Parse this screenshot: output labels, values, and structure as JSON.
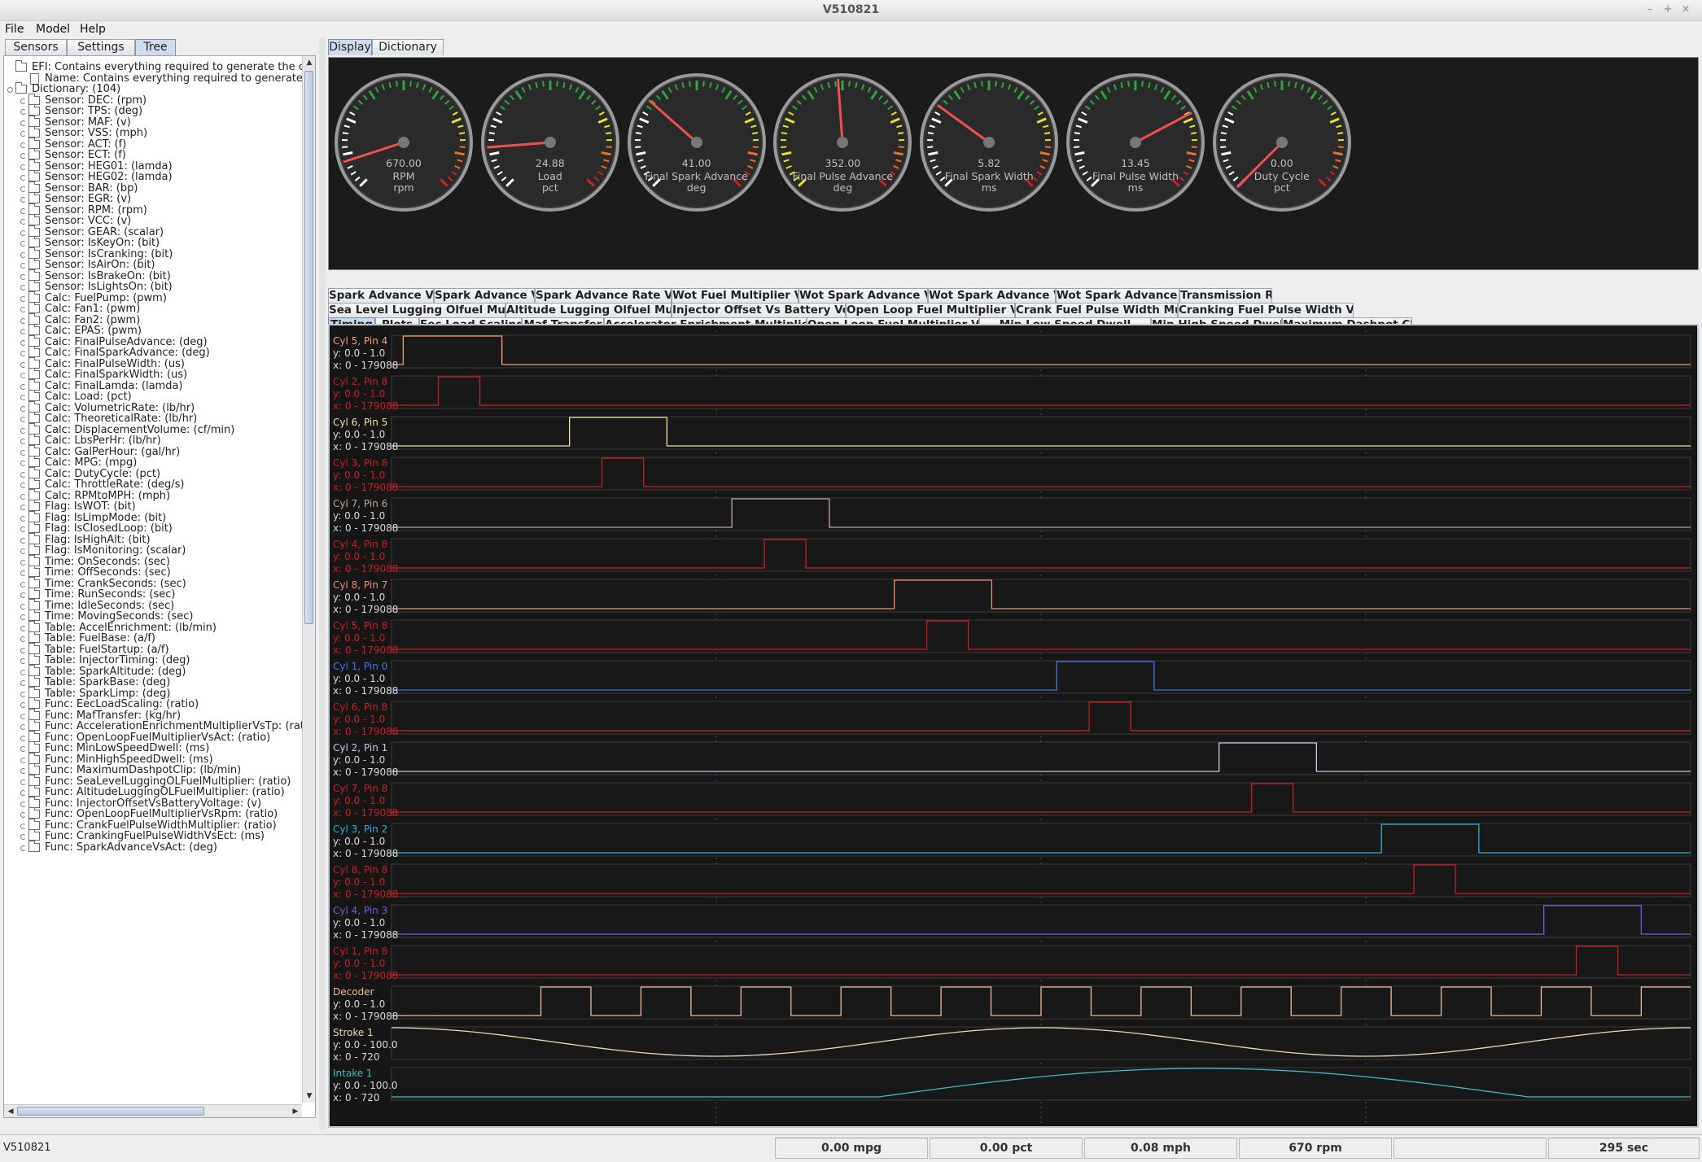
{
  "window": {
    "title": "V510821"
  },
  "menus": {
    "file": "File",
    "model": "Model",
    "help": "Help"
  },
  "left_tabs": {
    "sensors": "Sensors",
    "settings": "Settings",
    "tree": "Tree"
  },
  "tree": [
    {
      "label": "EFI: Contains everything required to generate the configuration",
      "level": 0,
      "kind": "folder",
      "toggle": false
    },
    {
      "label": "Name: Contains everything required to generate the configuration",
      "level": 1,
      "kind": "doc",
      "toggle": false
    },
    {
      "label": "Dictionary: (104)",
      "level": 0,
      "kind": "folder",
      "toggle": true
    },
    {
      "label": "Sensor: DEC: (rpm)",
      "level": 1,
      "kind": "folder",
      "toggle": true
    },
    {
      "label": "Sensor: TPS: (deg)",
      "level": 1,
      "kind": "folder",
      "toggle": true
    },
    {
      "label": "Sensor: MAF: (v)",
      "level": 1,
      "kind": "folder",
      "toggle": true
    },
    {
      "label": "Sensor: VSS: (mph)",
      "level": 1,
      "kind": "folder",
      "toggle": true
    },
    {
      "label": "Sensor: ACT: (f)",
      "level": 1,
      "kind": "folder",
      "toggle": true
    },
    {
      "label": "Sensor: ECT: (f)",
      "level": 1,
      "kind": "folder",
      "toggle": true
    },
    {
      "label": "Sensor: HEG01: (lamda)",
      "level": 1,
      "kind": "folder",
      "toggle": true
    },
    {
      "label": "Sensor: HEG02: (lamda)",
      "level": 1,
      "kind": "folder",
      "toggle": true
    },
    {
      "label": "Sensor: BAR: (bp)",
      "level": 1,
      "kind": "folder",
      "toggle": true
    },
    {
      "label": "Sensor: EGR: (v)",
      "level": 1,
      "kind": "folder",
      "toggle": true
    },
    {
      "label": "Sensor: RPM: (rpm)",
      "level": 1,
      "kind": "folder",
      "toggle": true
    },
    {
      "label": "Sensor: VCC: (v)",
      "level": 1,
      "kind": "folder",
      "toggle": true
    },
    {
      "label": "Sensor: GEAR: (scalar)",
      "level": 1,
      "kind": "folder",
      "toggle": true
    },
    {
      "label": "Sensor: IsKeyOn: (bit)",
      "level": 1,
      "kind": "folder",
      "toggle": true
    },
    {
      "label": "Sensor: IsCranking: (bit)",
      "level": 1,
      "kind": "folder",
      "toggle": true
    },
    {
      "label": "Sensor: IsAirOn: (bit)",
      "level": 1,
      "kind": "folder",
      "toggle": true
    },
    {
      "label": "Sensor: IsBrakeOn: (bit)",
      "level": 1,
      "kind": "folder",
      "toggle": true
    },
    {
      "label": "Sensor: IsLightsOn: (bit)",
      "level": 1,
      "kind": "folder",
      "toggle": true
    },
    {
      "label": "Calc: FuelPump: (pwm)",
      "level": 1,
      "kind": "folder",
      "toggle": true
    },
    {
      "label": "Calc: Fan1: (pwm)",
      "level": 1,
      "kind": "folder",
      "toggle": true
    },
    {
      "label": "Calc: Fan2: (pwm)",
      "level": 1,
      "kind": "folder",
      "toggle": true
    },
    {
      "label": "Calc: EPAS: (pwm)",
      "level": 1,
      "kind": "folder",
      "toggle": true
    },
    {
      "label": "Calc: FinalPulseAdvance: (deg)",
      "level": 1,
      "kind": "folder",
      "toggle": true
    },
    {
      "label": "Calc: FinalSparkAdvance: (deg)",
      "level": 1,
      "kind": "folder",
      "toggle": true
    },
    {
      "label": "Calc: FinalPulseWidth: (us)",
      "level": 1,
      "kind": "folder",
      "toggle": true
    },
    {
      "label": "Calc: FinalSparkWidth: (us)",
      "level": 1,
      "kind": "folder",
      "toggle": true
    },
    {
      "label": "Calc: FinalLamda: (lamda)",
      "level": 1,
      "kind": "folder",
      "toggle": true
    },
    {
      "label": "Calc: Load: (pct)",
      "level": 1,
      "kind": "folder",
      "toggle": true
    },
    {
      "label": "Calc: VolumetricRate: (lb/hr)",
      "level": 1,
      "kind": "folder",
      "toggle": true
    },
    {
      "label": "Calc: TheoreticalRate: (lb/hr)",
      "level": 1,
      "kind": "folder",
      "toggle": true
    },
    {
      "label": "Calc: DisplacementVolume: (cf/min)",
      "level": 1,
      "kind": "folder",
      "toggle": true
    },
    {
      "label": "Calc: LbsPerHr: (lb/hr)",
      "level": 1,
      "kind": "folder",
      "toggle": true
    },
    {
      "label": "Calc: GalPerHour: (gal/hr)",
      "level": 1,
      "kind": "folder",
      "toggle": true
    },
    {
      "label": "Calc: MPG: (mpg)",
      "level": 1,
      "kind": "folder",
      "toggle": true
    },
    {
      "label": "Calc: DutyCycle: (pct)",
      "level": 1,
      "kind": "folder",
      "toggle": true
    },
    {
      "label": "Calc: ThrottleRate: (deg/s)",
      "level": 1,
      "kind": "folder",
      "toggle": true
    },
    {
      "label": "Calc: RPMtoMPH: (mph)",
      "level": 1,
      "kind": "folder",
      "toggle": true
    },
    {
      "label": "Flag: IsWOT: (bit)",
      "level": 1,
      "kind": "folder",
      "toggle": true
    },
    {
      "label": "Flag: IsLimpMode: (bit)",
      "level": 1,
      "kind": "folder",
      "toggle": true
    },
    {
      "label": "Flag: IsClosedLoop: (bit)",
      "level": 1,
      "kind": "folder",
      "toggle": true
    },
    {
      "label": "Flag: IsHighAlt: (bit)",
      "level": 1,
      "kind": "folder",
      "toggle": true
    },
    {
      "label": "Flag: IsMonitoring: (scalar)",
      "level": 1,
      "kind": "folder",
      "toggle": true
    },
    {
      "label": "Time: OnSeconds: (sec)",
      "level": 1,
      "kind": "folder",
      "toggle": true
    },
    {
      "label": "Time: OffSeconds: (sec)",
      "level": 1,
      "kind": "folder",
      "toggle": true
    },
    {
      "label": "Time: CrankSeconds: (sec)",
      "level": 1,
      "kind": "folder",
      "toggle": true
    },
    {
      "label": "Time: RunSeconds: (sec)",
      "level": 1,
      "kind": "folder",
      "toggle": true
    },
    {
      "label": "Time: IdleSeconds: (sec)",
      "level": 1,
      "kind": "folder",
      "toggle": true
    },
    {
      "label": "Time: MovingSeconds: (sec)",
      "level": 1,
      "kind": "folder",
      "toggle": true
    },
    {
      "label": "Table: AccelEnrichment: (lb/min)",
      "level": 1,
      "kind": "folder",
      "toggle": true
    },
    {
      "label": "Table: FuelBase: (a/f)",
      "level": 1,
      "kind": "folder",
      "toggle": true
    },
    {
      "label": "Table: FuelStartup: (a/f)",
      "level": 1,
      "kind": "folder",
      "toggle": true
    },
    {
      "label": "Table: InjectorTiming: (deg)",
      "level": 1,
      "kind": "folder",
      "toggle": true
    },
    {
      "label": "Table: SparkAltitude: (deg)",
      "level": 1,
      "kind": "folder",
      "toggle": true
    },
    {
      "label": "Table: SparkBase: (deg)",
      "level": 1,
      "kind": "folder",
      "toggle": true
    },
    {
      "label": "Table: SparkLimp: (deg)",
      "level": 1,
      "kind": "folder",
      "toggle": true
    },
    {
      "label": "Func: EecLoadScaling: (ratio)",
      "level": 1,
      "kind": "folder",
      "toggle": true
    },
    {
      "label": "Func: MafTransfer: (kg/hr)",
      "level": 1,
      "kind": "folder",
      "toggle": true
    },
    {
      "label": "Func: AccelerationEnrichmentMultiplierVsTp: (ratio)",
      "level": 1,
      "kind": "folder",
      "toggle": true
    },
    {
      "label": "Func: OpenLoopFuelMultiplierVsAct: (ratio)",
      "level": 1,
      "kind": "folder",
      "toggle": true
    },
    {
      "label": "Func: MinLowSpeedDwell: (ms)",
      "level": 1,
      "kind": "folder",
      "toggle": true
    },
    {
      "label": "Func: MinHighSpeedDwell: (ms)",
      "level": 1,
      "kind": "folder",
      "toggle": true
    },
    {
      "label": "Func: MaximumDashpotClip: (lb/min)",
      "level": 1,
      "kind": "folder",
      "toggle": true
    },
    {
      "label": "Func: SeaLevelLuggingOLFuelMultiplier: (ratio)",
      "level": 1,
      "kind": "folder",
      "toggle": true
    },
    {
      "label": "Func: AltitudeLuggingOLFuelMultiplier: (ratio)",
      "level": 1,
      "kind": "folder",
      "toggle": true
    },
    {
      "label": "Func: InjectorOffsetVsBatteryVoltage: (v)",
      "level": 1,
      "kind": "folder",
      "toggle": true
    },
    {
      "label": "Func: OpenLoopFuelMultiplierVsRpm: (ratio)",
      "level": 1,
      "kind": "folder",
      "toggle": true
    },
    {
      "label": "Func: CrankFuelPulseWidthMultiplier: (ratio)",
      "level": 1,
      "kind": "folder",
      "toggle": true
    },
    {
      "label": "Func: CrankingFuelPulseWidthVsEct: (ms)",
      "level": 1,
      "kind": "folder",
      "toggle": true
    },
    {
      "label": "Func: SparkAdvanceVsAct: (deg)",
      "level": 1,
      "kind": "folder",
      "toggle": true
    }
  ],
  "right_tabs": {
    "display": "Display",
    "dictionary": "Dictionary"
  },
  "gauges": [
    {
      "value": "670.00",
      "name": "RPM",
      "unit": "rpm",
      "needle_fraction": 0.1
    },
    {
      "value": "24.88",
      "name": "Load",
      "unit": "pct",
      "needle_fraction": 0.15
    },
    {
      "value": "41.00",
      "name": "Final Spark Advance",
      "unit": "deg",
      "needle_fraction": 0.32
    },
    {
      "value": "352.00",
      "name": "Final Pulse Advance",
      "unit": "deg",
      "needle_fraction": 0.485
    },
    {
      "value": "5.82",
      "name": "Final Spark Width",
      "unit": "ms",
      "needle_fraction": 0.3
    },
    {
      "value": "13.45",
      "name": "Final Pulse Width",
      "unit": "ms",
      "needle_fraction": 0.73
    },
    {
      "value": "0.00",
      "name": "Duty Cycle",
      "unit": "pct",
      "needle_fraction": 0.0
    }
  ],
  "plot_tab_rows": [
    [
      "Spark Advance Vs Act",
      "Spark Advance Vs Bp",
      "Spark Advance Rate Vs Rpm",
      "Wot Fuel Multiplier Vs Rpm",
      "Wot Spark Advance Vs Rpm",
      "Wot Spark Advance Vs Ect",
      "Wot Spark Advance Vs Act",
      "Transmission Ratio"
    ],
    [
      "Sea Level Lugging Olfuel Multiplier",
      "Altitude Lugging Olfuel Multiplier",
      "Injector Offset Vs Battery Voltage",
      "Open Loop Fuel Multiplier Vs Rpm",
      "Crank Fuel Pulse Width Multiplier",
      "Cranking Fuel Pulse Width Vs Ect"
    ],
    [
      "Timing",
      "Plots",
      "Eec Load Scaling",
      "Maf Transfer",
      "Accelerator Enrichment Multiplier Vs Tp",
      "Open Loop Fuel Multiplier Vs Act",
      "Min Low Speed Dwell",
      "Min High Speed Dwell",
      "Maximum Dashpot Clip"
    ]
  ],
  "selected_plot_tab": "Timing",
  "traces": [
    {
      "name": "Cyl 5, Pin 4",
      "y": "y: 0.0 - 1.0",
      "x": "x: 0 - 179088",
      "color": "#f0a070",
      "kind": "pulse",
      "on": 0.009,
      "off": 0.085
    },
    {
      "name": "Cyl 2, Pin 8",
      "y": "y: 0.0 - 1.0",
      "x": "x: 0 - 179088",
      "color": "#c82020",
      "kind": "pulse",
      "on": 0.036,
      "off": 0.068
    },
    {
      "name": "Cyl 6, Pin 5",
      "y": "y: 0.0 - 1.0",
      "x": "x: 0 - 179088",
      "color": "#f0e0a0",
      "kind": "pulse",
      "on": 0.137,
      "off": 0.212
    },
    {
      "name": "Cyl 3, Pin 8",
      "y": "y: 0.0 - 1.0",
      "x": "x: 0 - 179088",
      "color": "#c82020",
      "kind": "pulse",
      "on": 0.162,
      "off": 0.194
    },
    {
      "name": "Cyl 7, Pin 6",
      "y": "y: 0.0 - 1.0",
      "x": "x: 0 - 179088",
      "color": "#c0a898",
      "kind": "pulse",
      "on": 0.262,
      "off": 0.337
    },
    {
      "name": "Cyl 4, Pin 8",
      "y": "y: 0.0 - 1.0",
      "x": "x: 0 - 179088",
      "color": "#c82020",
      "kind": "pulse",
      "on": 0.287,
      "off": 0.319
    },
    {
      "name": "Cyl 8, Pin 7",
      "y": "y: 0.0 - 1.0",
      "x": "x: 0 - 179088",
      "color": "#f09070",
      "kind": "pulse",
      "on": 0.387,
      "off": 0.462
    },
    {
      "name": "Cyl 5, Pin 8",
      "y": "y: 0.0 - 1.0",
      "x": "x: 0 - 179088",
      "color": "#c82020",
      "kind": "pulse",
      "on": 0.412,
      "off": 0.444
    },
    {
      "name": "Cyl 1, Pin 0",
      "y": "y: 0.0 - 1.0",
      "x": "x: 0 - 179088",
      "color": "#3a78e8",
      "kind": "pulse",
      "on": 0.512,
      "off": 0.587
    },
    {
      "name": "Cyl 6, Pin 8",
      "y": "y: 0.0 - 1.0",
      "x": "x: 0 - 179088",
      "color": "#c82020",
      "kind": "pulse",
      "on": 0.537,
      "off": 0.569
    },
    {
      "name": "Cyl 2, Pin 1",
      "y": "y: 0.0 - 1.0",
      "x": "x: 0 - 179088",
      "color": "#c8c8e8",
      "kind": "pulse",
      "on": 0.637,
      "off": 0.712
    },
    {
      "name": "Cyl 7, Pin 8",
      "y": "y: 0.0 - 1.0",
      "x": "x: 0 - 179088",
      "color": "#c82020",
      "kind": "pulse",
      "on": 0.662,
      "off": 0.694
    },
    {
      "name": "Cyl 3, Pin 2",
      "y": "y: 0.0 - 1.0",
      "x": "x: 0 - 179088",
      "color": "#30b0d8",
      "kind": "pulse",
      "on": 0.762,
      "off": 0.837
    },
    {
      "name": "Cyl 8, Pin 8",
      "y": "y: 0.0 - 1.0",
      "x": "x: 0 - 179088",
      "color": "#c82020",
      "kind": "pulse",
      "on": 0.787,
      "off": 0.819
    },
    {
      "name": "Cyl 4, Pin 3",
      "y": "y: 0.0 - 1.0",
      "x": "x: 0 - 179088",
      "color": "#7060d8",
      "kind": "pulse",
      "on": 0.887,
      "off": 0.962
    },
    {
      "name": "Cyl 1, Pin 8",
      "y": "y: 0.0 - 1.0",
      "x": "x: 0 - 179088",
      "color": "#c82020",
      "kind": "pulse",
      "on": 0.912,
      "off": 0.944
    },
    {
      "name": "Decoder",
      "y": "y: 0.0 - 1.0",
      "x": "x: 0 - 179088",
      "color": "#f0b898",
      "kind": "square",
      "start": 0.115,
      "period": 0.077
    },
    {
      "name": "Stroke 1",
      "y": "y: 0.0 - 100.0",
      "x": "x: 0 - 720",
      "color": "#f0d8b0",
      "kind": "cosine"
    },
    {
      "name": "Intake 1",
      "y": "y: 0.0 - 100.0",
      "x": "x: 0 - 720",
      "color": "#40b8c8",
      "kind": "intake"
    }
  ],
  "status": {
    "left": "V510821",
    "mpg": "0.00 mpg",
    "pct": "0.00 pct",
    "mph": "0.08 mph",
    "rpm": "670 rpm",
    "blank": "",
    "sec": "295 sec"
  }
}
